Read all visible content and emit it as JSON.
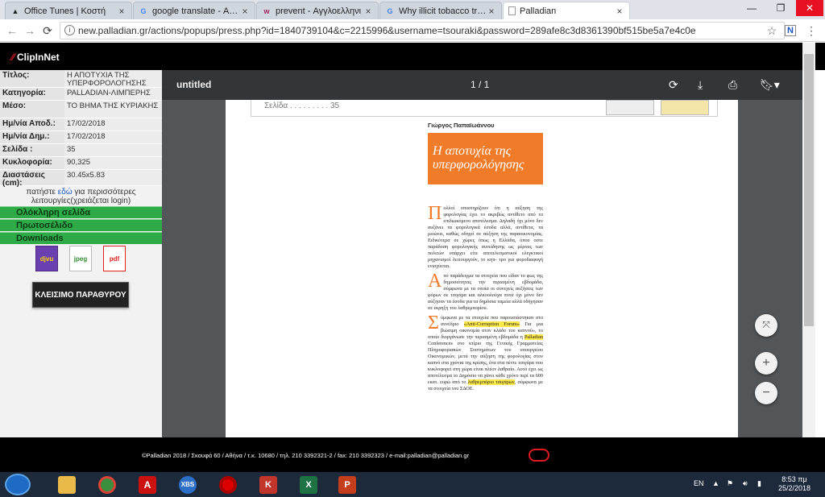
{
  "browser": {
    "tabs": [
      {
        "label": "Office Tunes | Κοστή",
        "icon": "triangle-icon"
      },
      {
        "label": "google translate - Αναζ",
        "icon": "google-icon"
      },
      {
        "label": "prevent - Αγγλοελληνι",
        "icon": "wr-icon"
      },
      {
        "label": "Why illicit tobacco trade",
        "icon": "google-icon"
      },
      {
        "label": "Palladian",
        "icon": "page-icon"
      }
    ],
    "url": "new.palladian.gr/actions/popups/press.php?id=1840739104&c=2215996&username=tsouraki&password=289afe8c3d8361390bf515be5a7e4c0e"
  },
  "clipinnet": {
    "logo": "ClipInNet"
  },
  "sidebar": {
    "info": [
      {
        "key": "Τίτλος:",
        "value": "Η ΑΠΟΤΥΧΙΑ ΤΗΣ ΥΠΕΡΦΟΡΟΛΟΓΗΣΗΣ"
      },
      {
        "key": "Κατηγορία:",
        "value": "PALLADIAN-ΛΙΜΠΕΡΗΣ"
      },
      {
        "key": "Μέσο:",
        "value": "ΤΟ ΒΗΜΑ ΤΗΣ ΚΥΡΙΑΚΗΣ"
      },
      {
        "key": "Ημ/νία Αποδ.:",
        "value": "17/02/2018"
      },
      {
        "key": "Ημ/νία Δημ.:",
        "value": "17/02/2018"
      },
      {
        "key": "Σελίδα :",
        "value": "35"
      },
      {
        "key": "Κυκλοφορία:",
        "value": "90,325"
      },
      {
        "key": "Διαστάσεις (cm):",
        "value": "30.45x5.83"
      }
    ],
    "login_note_pre": "πατήστε",
    "login_note_link": "εδώ",
    "login_note_post": "για περισσότερες λειτουργίες(χρειάζεται login)",
    "links": [
      "Ολόκληρη σελίδα",
      "Πρωτοσέλιδο",
      "Downloads"
    ],
    "downloads": [
      "djvu",
      "jpeg",
      "pdf"
    ],
    "close_window": "ΚΛΕΙΣΙΜΟ ΠΑΡΑΘΥΡΟΥ"
  },
  "viewer": {
    "title": "untitled",
    "page": "1 / 1",
    "strip_text": "Σελίδα . . . . . . . . . 35",
    "article": {
      "author": "Γιώργος Παπαϊωάννου",
      "headline": "Η αποτυχία της υπερφορολόγησης",
      "drop1": "Π",
      "p1": "ολλοί υποστηρίζουν ότι η αύξηση της φορολογίας έχει το ακριβώς αντίθετο από το επιδιωκόμενο αποτέλεσμα. Δηλαδή όχι μόνο δεν αυξάνει τα φορολογικά έσοδα αλλά, αντίθετα, τα μειώνει, καθώς οδηγεί σε αύξηση της παραοικονομίας. Ειδικότερα σε χώρες όπως η Ελλάδα, όπου οστε παράδοση φορολογικής συνείδησης ως μέρους των πολιτών υπάρχει είτε αποτελεσματικοί ελεγκτικοί μηχανισμοί λειτουργούν, το κηπ- τρο για φοροδιαφυγή ενισχύεται.",
      "drop2": "Α",
      "p2": "πό παράδειγμα τα στοιχεία που είδαν το φως της δημοσιότητας την περασμένη εβδομάδα, σύμφωνα με τα οποία οι συνεχείς αυξήσεις των φόρων σε τσιγάρα και αλκοολούχα ποτά όχι μόνο δεν αύξησαν τα έσοδα για τα δημόσια ταμεία αλλά οδήγησαν σε έκρηξη του λαθρεμπορίου.",
      "drop3": "Σ",
      "p3a": "ύμφωνα με τα στοιχεία που παρουσιάστηκαν στο συνέδριο",
      "p3hl1": "«Anti-Corruption Forum»",
      "p3b": "Για μια βιώσιμη οικονομία στον κλάδο του καπνού», το οποίο διοργάνωσε την περασμένη εβδομάδα η",
      "p3hl2": "Palladian",
      "p3c": "Conferences στο κτίριο της Γενικής Γραμματείας Πληροφοριακών Συστημάτων του υπουργείου Οικονομικών, μετά την αύξηση της φορολογίας στον καπνό στα χρόνια της κρίσης, ένα στα πέντε τσιγάρα που κυκλοφορεί στη χώρα είναι πλέον λαθραίο. Αυτό έχει ως αποτέλεσμα το Δημόσιο να χάνει κάθε χρόνο περί τα 600 εκατ. ευρώ από το",
      "p3hl3": "λαθρεμπόριο τσιγάρων",
      "p3d": ", σύμφωνα με τα στοιχεία του ΣΔΟΕ."
    }
  },
  "footer": {
    "text": "©Palladian 2018 / Σκουφά 60 / Αθήνα / τ.κ. 10680 / τηλ. 210 3392321-2 / fax: 210 3392323 / e-mail:palladian@palladian.gr"
  },
  "taskbar": {
    "lang": "EN",
    "time": "8:53 πμ",
    "date": "25/2/2018"
  },
  "colors": {
    "accent_orange": "#f07c2a",
    "green_link": "#2eaa48",
    "highlight": "#ffe94a"
  }
}
